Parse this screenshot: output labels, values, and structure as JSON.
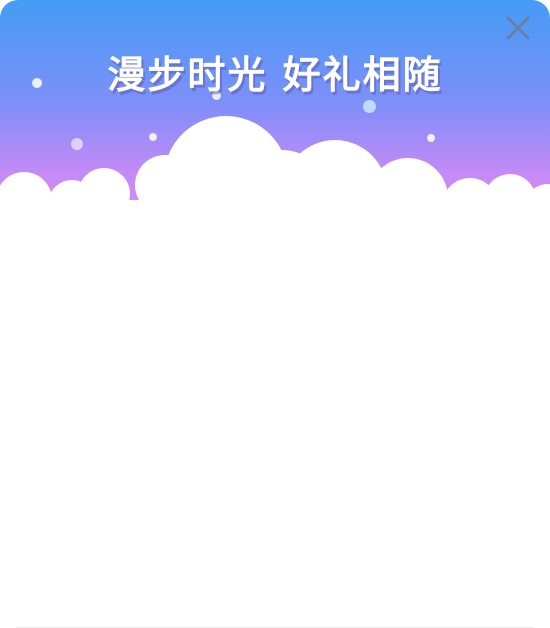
{
  "dialog": {
    "title": "漫步时光  好礼相随",
    "close_icon": "close-icon",
    "colors": {
      "gradient_top": "#449cf6",
      "gradient_mid": "#7e8ff8",
      "gradient_bottom": "#e687f5",
      "close_icon": "#6a7fa8",
      "body": "#ffffff"
    }
  }
}
